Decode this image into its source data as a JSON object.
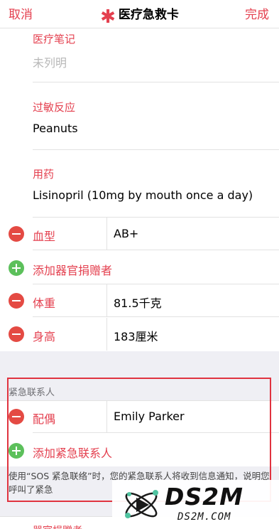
{
  "navbar": {
    "cancel_label": "取消",
    "title": "医疗急救卡",
    "done_label": "完成"
  },
  "fields": [
    {
      "label": "医疗笔记",
      "value": "未列明",
      "placeholder": true
    },
    {
      "label": "过敏反应",
      "value": "Peanuts",
      "placeholder": false
    },
    {
      "label": "用药",
      "value": "Lisinopril (10mg by mouth once a day)",
      "placeholder": false
    }
  ],
  "rows": {
    "blood_type": {
      "label": "血型",
      "value": "AB+"
    },
    "add_organ_donor": {
      "label": "添加器官捐赠者"
    },
    "weight": {
      "label": "体重",
      "value": "81.5千克"
    },
    "height": {
      "label": "身高",
      "value": "183厘米"
    }
  },
  "emergency_contacts": {
    "header": "紧急联系人",
    "contact": {
      "label": "配偶",
      "value": "Emily Parker"
    },
    "add_label": "添加紧急联系人",
    "note": "使用“SOS 紧急联络”时，您的紧急联系人将收到信息通知，说明您呼叫了紧急"
  },
  "next_section_partial": "器官捐赠者",
  "watermark": {
    "brand": "DS2M",
    "url": "DS2M.COM"
  },
  "colors": {
    "accent": "#e4404f",
    "minus": "#e44a43",
    "plus": "#5cc05b",
    "highlight": "#e0333f"
  }
}
